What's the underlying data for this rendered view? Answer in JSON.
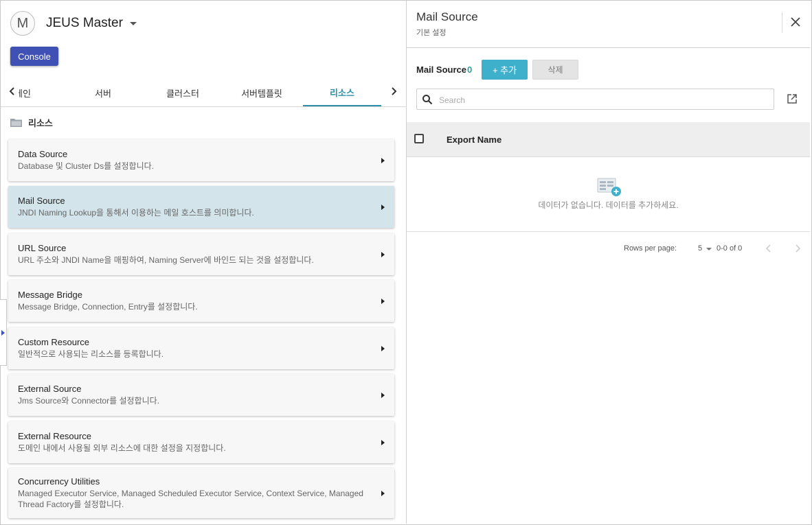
{
  "app": {
    "avatar_letter": "M",
    "title": "JEUS Master",
    "console_label": "Console"
  },
  "tabs": [
    {
      "label": "메인"
    },
    {
      "label": "서버"
    },
    {
      "label": "클러스터"
    },
    {
      "label": "서버템플릿"
    },
    {
      "label": "리소스",
      "active": true
    }
  ],
  "section": {
    "label": "리소스",
    "icon": "folder-icon"
  },
  "cards": [
    {
      "title": "Data Source",
      "desc": "Database 및 Cluster Ds를 설정합니다."
    },
    {
      "title": "Mail Source",
      "desc": "JNDI Naming Lookup을 통해서 이용하는 메일 호스트를 의미합니다.",
      "selected": true
    },
    {
      "title": "URL Source",
      "desc": "URL 주소와 JNDI Name을 매핑하여, Naming Server에 바인드 되는 것을 설정합니다."
    },
    {
      "title": "Message Bridge",
      "desc": "Message Bridge, Connection, Entry를 설정합니다."
    },
    {
      "title": "Custom Resource",
      "desc": "일반적으로 사용되는 리소스를 등록합니다."
    },
    {
      "title": "External Source",
      "desc": "Jms Source와 Connector를 설정합니다."
    },
    {
      "title": "External Resource",
      "desc": "도메인 내에서 사용될 외부 리소스에 대한 설정을 지정합니다."
    },
    {
      "title": "Concurrency Utilities",
      "desc": "Managed Executor Service, Managed Scheduled Executor Service, Context Service, Managed Thread Factory를 설정합니다."
    }
  ],
  "detail": {
    "title": "Mail Source",
    "subtitle": "기본 설정",
    "list_label": "Mail Source",
    "count": "0",
    "add_label": "+ 추가",
    "delete_label": "삭제",
    "search_placeholder": "Search",
    "column_export_name": "Export Name",
    "empty_text": "데이터가 없습니다. 데이터를 추가하세요.",
    "rows_per_page_label": "Rows per page:",
    "rows_per_page_value": "5",
    "range_text": "0-0 of 0"
  },
  "colors": {
    "primary": "#3f51b5",
    "accent": "#2c8fa8",
    "add_button": "#3fb0cc",
    "selected_card": "#d3e4ea",
    "count": "#2aa198"
  }
}
